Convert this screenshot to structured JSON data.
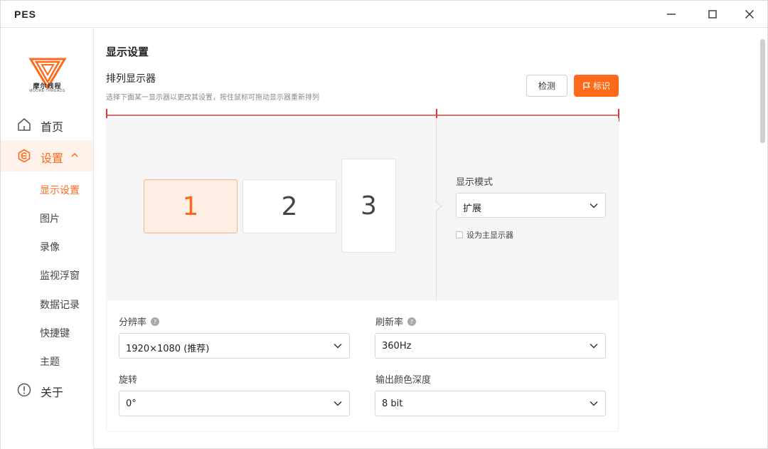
{
  "window": {
    "app_title": "PES"
  },
  "logo": {
    "name_cn": "摩尔线程",
    "name_en": "MOORE THREADS"
  },
  "sidebar": {
    "items": [
      {
        "label": "首页",
        "icon": "home-icon"
      },
      {
        "label": "设置",
        "icon": "settings-e-icon",
        "active": true
      },
      {
        "label": "关于",
        "icon": "info-icon"
      }
    ],
    "sub_items": [
      {
        "label": "显示设置",
        "active": true
      },
      {
        "label": "图片"
      },
      {
        "label": "录像"
      },
      {
        "label": "监视浮窗"
      },
      {
        "label": "数据记录"
      },
      {
        "label": "快捷键"
      },
      {
        "label": "主题"
      }
    ]
  },
  "main": {
    "page_title": "显示设置",
    "section_title": "排列显示器",
    "section_desc": "选择下面某一显示器以更改其设置，按住鼠标可拖动显示器重新排列",
    "detect_label": "检测",
    "identify_label": "标识",
    "monitors": [
      "1",
      "2",
      "3"
    ],
    "display_mode": {
      "label": "显示模式",
      "value": "扩展"
    },
    "set_primary_label": "设为主显示器",
    "resolution": {
      "label": "分辨率",
      "value": "1920×1080 (推荐)"
    },
    "refresh_rate": {
      "label": "刷新率",
      "value": "360Hz"
    },
    "rotation": {
      "label": "旋转",
      "value": "0°"
    },
    "color_depth": {
      "label": "输出颜色深度",
      "value": "8 bit"
    }
  },
  "colors": {
    "accent": "#ff6a1a",
    "accent_light": "#ffeee3",
    "ruler": "#e53935"
  }
}
